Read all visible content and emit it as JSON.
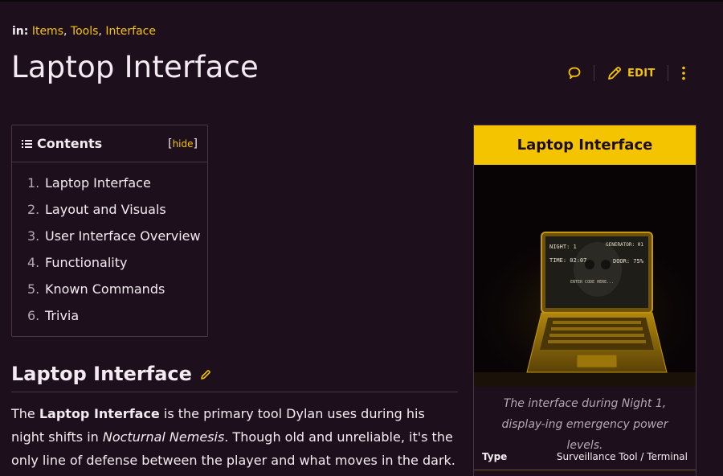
{
  "breadcrumb": {
    "prefix": "in:",
    "categories": [
      "Items",
      "Tools",
      "Interface"
    ]
  },
  "page_title": "Laptop Interface",
  "actions": {
    "edit_label": "EDIT",
    "icons": [
      "talk-bubble-icon",
      "pencil-icon",
      "kebab-menu-icon"
    ]
  },
  "toc": {
    "title": "Contents",
    "hide_label": "hide",
    "items": [
      {
        "num": "1.",
        "label": "Laptop Interface"
      },
      {
        "num": "2.",
        "label": "Layout and Visuals"
      },
      {
        "num": "3.",
        "label": "User Interface Overview"
      },
      {
        "num": "4.",
        "label": "Functionality"
      },
      {
        "num": "5.",
        "label": "Known Commands"
      },
      {
        "num": "6.",
        "label": "Trivia"
      }
    ]
  },
  "section": {
    "heading": "Laptop Interface"
  },
  "paragraph": {
    "t1": "The ",
    "bold": "Laptop Interface",
    "t2": " is the primary tool Dylan uses during his night shifts in ",
    "italic": "Nocturnal Nemesis",
    "t3": ". Though old and unreliable, it's the only line of defense between the player and what moves in the dark."
  },
  "infobox": {
    "title": "Laptop Interface",
    "screen": {
      "night": "NIGHT: 1",
      "generator": "GENERATOR: 01",
      "time": "TIME: 02:07",
      "door": "DOOR: 75%",
      "prompt": "ENTER CODE HERE..."
    },
    "caption": "The interface during Night 1, display-ing emergency power levels.",
    "rows": [
      {
        "label": "Type",
        "value": "Surveillance Tool / Terminal"
      }
    ]
  },
  "colors": {
    "background": "#1e0f1c",
    "accent": "#f5c400",
    "border": "#4a3446",
    "muted_text": "#b7a8b5"
  }
}
